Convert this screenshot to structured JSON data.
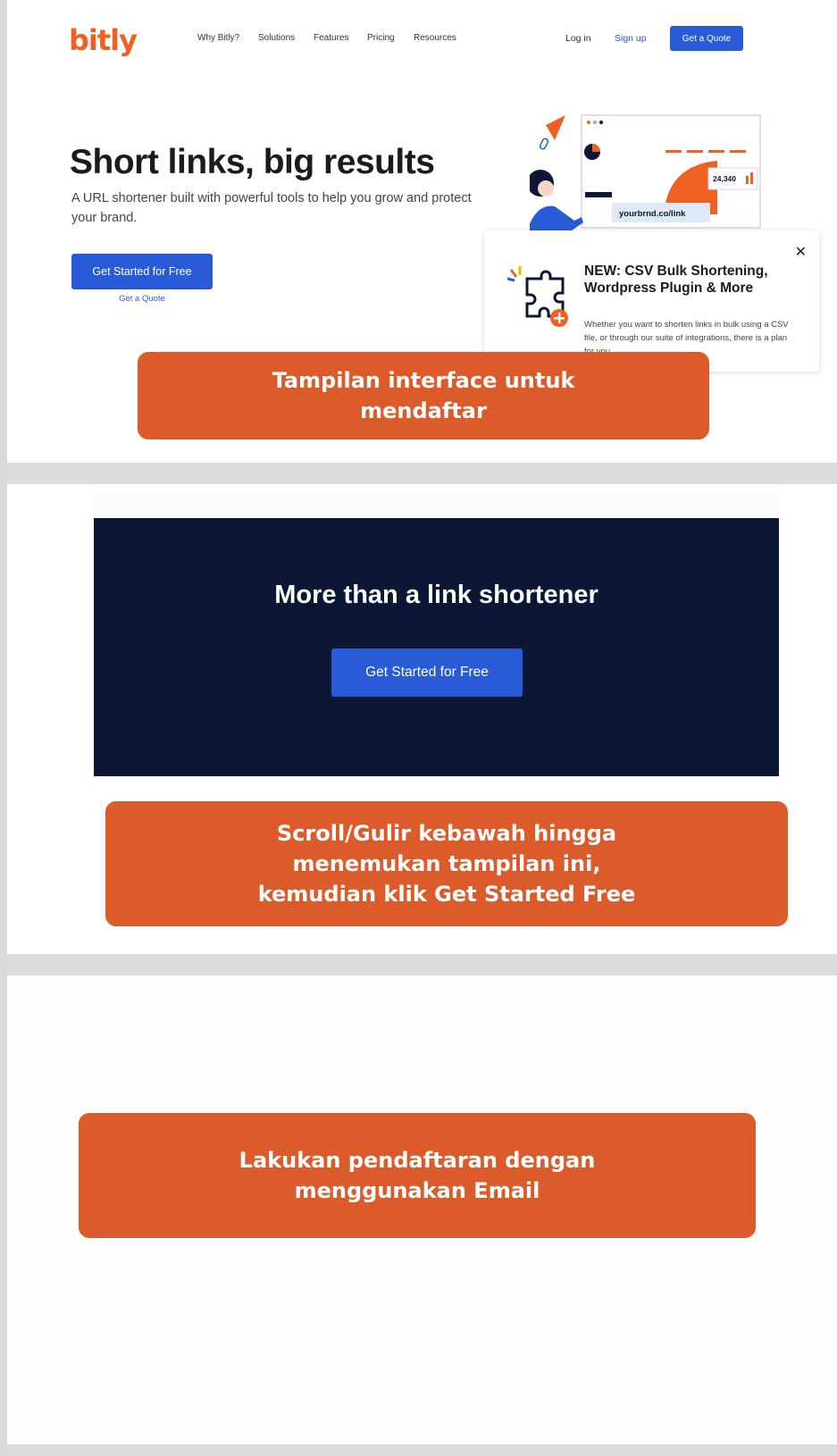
{
  "nav": {
    "logo": "bitly",
    "links": [
      "Why Bitly?",
      "Solutions",
      "Features",
      "Pricing",
      "Resources"
    ],
    "login": "Log in",
    "signup": "Sign up",
    "quote_button": "Get a Quote"
  },
  "hero": {
    "title": "Short links, big results",
    "subtitle": "A URL shortener built with powerful tools to help you grow and protect your brand.",
    "cta": "Get Started for Free",
    "secondary_link": "Get a Quote",
    "illustration": {
      "stat": "24,340",
      "link": "yourbrnd.co/link"
    }
  },
  "popup": {
    "title": "NEW: CSV Bulk Shortening, Wordpress Plugin & More",
    "text": "Whether you want to shorten links in bulk using a CSV file, or through our suite of integrations, there is a plan for you.",
    "close_icon": "close-icon"
  },
  "banner": {
    "title": "More than a link shortener",
    "cta": "Get Started for Free"
  },
  "callouts": {
    "c1": "Tampilan interface untuk\nmendaftar",
    "c2": "Scroll/Gulir kebawah hingga\nmenemukan tampilan ini,\nkemudian klik Get Started Free",
    "c3": "Lakukan pendaftaran dengan\nmenggunakan Email"
  },
  "colors": {
    "brand": "#ee6123",
    "primary_button": "#2a5bd7",
    "callout": "#db5b2b",
    "dark_banner": "#0b1734"
  }
}
